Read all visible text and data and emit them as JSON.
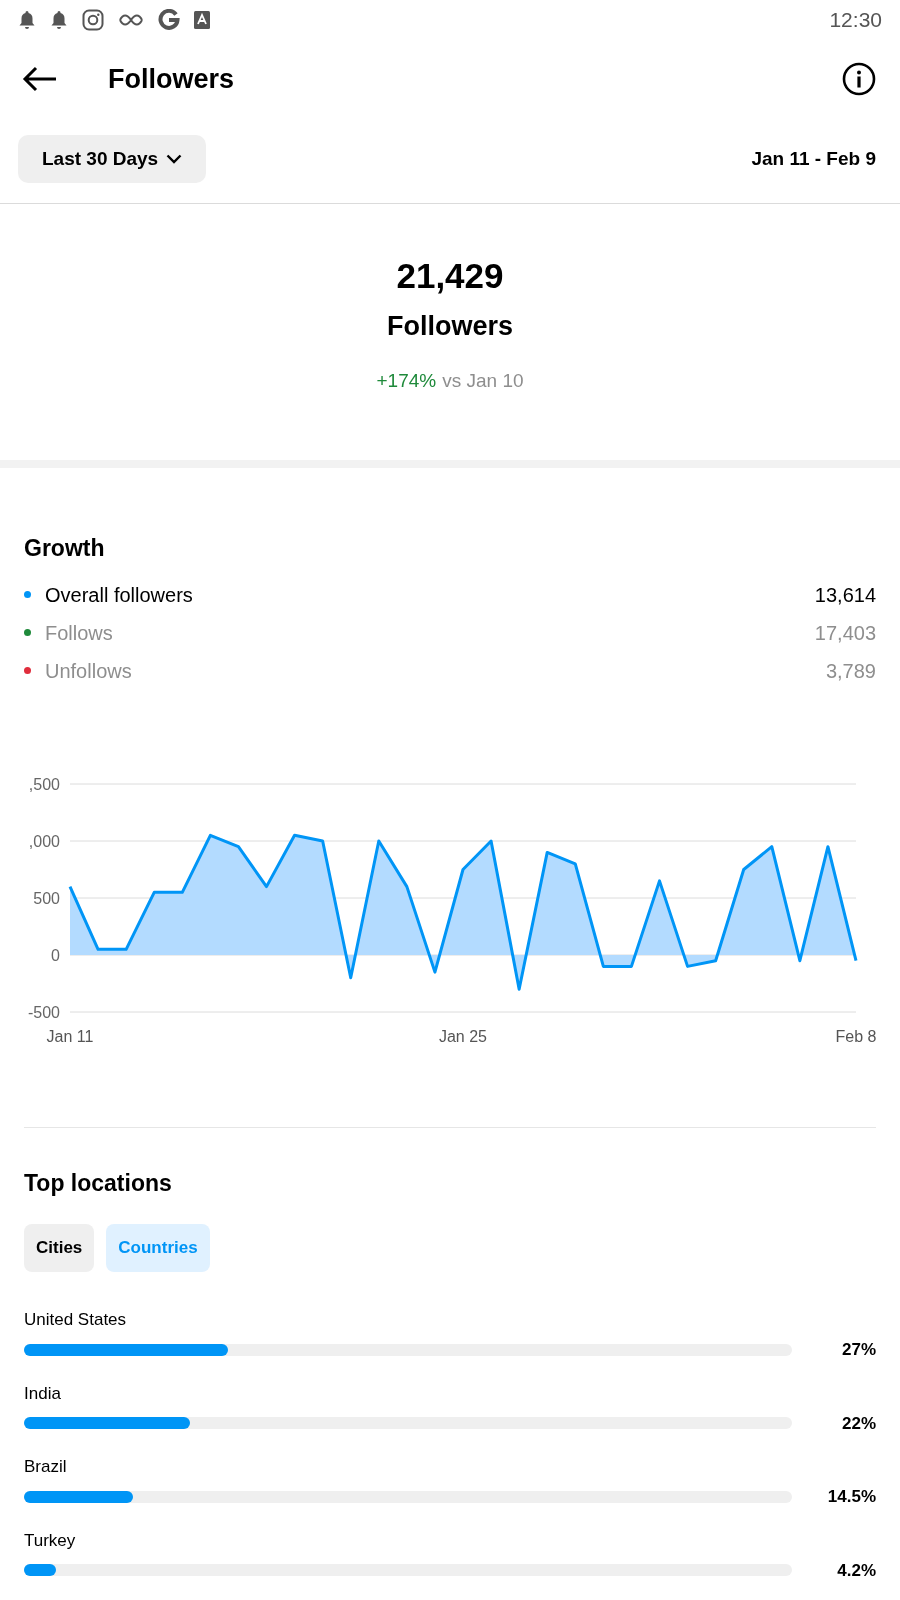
{
  "status_bar": {
    "time": "12:30"
  },
  "header": {
    "title": "Followers"
  },
  "filter": {
    "range": "Last 30 Days",
    "dates": "Jan 11 - Feb 9"
  },
  "summary": {
    "total": "21,429",
    "label": "Followers",
    "change": "+174%",
    "comparison": "vs Jan 10"
  },
  "growth": {
    "title": "Growth",
    "legend": [
      {
        "label": "Overall followers",
        "value": "13,614",
        "color": "#0095f6",
        "selected": true
      },
      {
        "label": "Follows",
        "value": "17,403",
        "color": "#1f8a3b",
        "selected": false
      },
      {
        "label": "Unfollows",
        "value": "3,789",
        "color": "#e02d3c",
        "selected": false
      }
    ],
    "cut_tick_labels": [
      ",500",
      ",000"
    ],
    "chart_data": {
      "type": "area",
      "categories": [
        "Jan 11",
        null,
        null,
        null,
        null,
        null,
        null,
        null,
        null,
        null,
        null,
        null,
        null,
        null,
        "Jan 25",
        null,
        null,
        null,
        null,
        null,
        null,
        null,
        null,
        null,
        null,
        null,
        null,
        null,
        "Feb 8"
      ],
      "series": [
        {
          "color": "#0095f6",
          "values": [
            600,
            50,
            50,
            550,
            550,
            1050,
            950,
            600,
            1050,
            1000,
            -200,
            1000,
            600,
            -150,
            750,
            1000,
            -300,
            900,
            800,
            -100,
            -100,
            650,
            -100,
            -50,
            750,
            950,
            -50,
            950,
            -50
          ]
        }
      ],
      "ylim": [
        -500,
        1500
      ],
      "yticks": [
        -500,
        0,
        500
      ]
    }
  },
  "locations": {
    "title": "Top locations",
    "tabs": [
      {
        "label": "Cities",
        "selected": false
      },
      {
        "label": "Countries",
        "selected": true
      }
    ],
    "items": [
      {
        "name": "United States",
        "level": 0.27,
        "percent": "27%"
      },
      {
        "name": "India",
        "level": 0.22,
        "percent": "22%"
      },
      {
        "name": "Brazil",
        "level": 0.145,
        "percent": "14.5%"
      },
      {
        "name": "Turkey",
        "level": 0.042,
        "percent": "4.2%"
      }
    ]
  }
}
